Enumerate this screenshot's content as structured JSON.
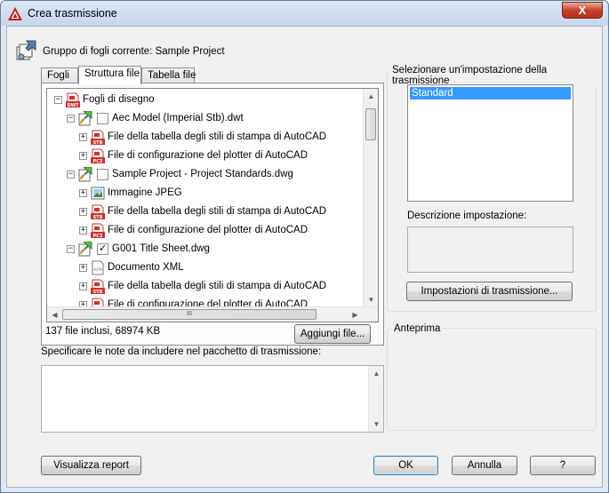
{
  "window": {
    "title": "Crea trasmissione",
    "close_label": "X"
  },
  "header": {
    "label": "Gruppo di fogli corrente: Sample Project"
  },
  "tabs": [
    {
      "label": "Fogli",
      "active": false
    },
    {
      "label": "Struttura file",
      "active": true
    },
    {
      "label": "Tabella file",
      "active": false
    }
  ],
  "tree": {
    "rows": [
      {
        "indent": 0,
        "expander": "−",
        "icon": "dwt-file-icon",
        "checkbox": null,
        "label": "Fogli di disegno"
      },
      {
        "indent": 1,
        "expander": "−",
        "icon": "drawing-icon",
        "checkbox": false,
        "label": "Aec Model (Imperial Stb).dwt"
      },
      {
        "indent": 2,
        "expander": "+",
        "icon": "stb-file-icon",
        "checkbox": null,
        "label": "File della tabella degli stili di stampa di AutoCAD"
      },
      {
        "indent": 2,
        "expander": "+",
        "icon": "pc3-file-icon",
        "checkbox": null,
        "label": "File di configurazione del plotter di AutoCAD"
      },
      {
        "indent": 1,
        "expander": "−",
        "icon": "drawing-icon",
        "checkbox": false,
        "label": "Sample Project - Project Standards.dwg"
      },
      {
        "indent": 2,
        "expander": "+",
        "icon": "jpeg-image-icon",
        "checkbox": null,
        "label": "Immagine JPEG"
      },
      {
        "indent": 2,
        "expander": "+",
        "icon": "stb-file-icon",
        "checkbox": null,
        "label": "File della tabella degli stili di stampa di AutoCAD"
      },
      {
        "indent": 2,
        "expander": "+",
        "icon": "pc3-file-icon",
        "checkbox": null,
        "label": "File di configurazione del plotter di AutoCAD"
      },
      {
        "indent": 1,
        "expander": "−",
        "icon": "drawing-icon",
        "checkbox": true,
        "label": "G001 Title Sheet.dwg"
      },
      {
        "indent": 2,
        "expander": "+",
        "icon": "xml-document-icon",
        "checkbox": null,
        "label": "Documento XML"
      },
      {
        "indent": 2,
        "expander": "+",
        "icon": "stb-file-icon",
        "checkbox": null,
        "label": "File della tabella degli stili di stampa di AutoCAD"
      },
      {
        "indent": 2,
        "expander": "+",
        "icon": "pc3-file-icon",
        "checkbox": null,
        "label": "File di configurazione del plotter di AutoCAD"
      }
    ],
    "hscroll_grip": "III"
  },
  "file_count": "137 file inclusi, 68974 KB",
  "add_file_button": "Aggiungi file...",
  "notes": {
    "label": "Specificare le note da includere nel pacchetto di trasmissione:",
    "value": ""
  },
  "setup_group": {
    "title": "Selezionare un'impostazione della trasmissione",
    "items": [
      "Standard"
    ],
    "selected": "Standard",
    "description_label": "Descrizione impostazione:",
    "description_value": "",
    "setups_button": "Impostazioni di trasmissione..."
  },
  "preview_group": {
    "title": "Anteprima"
  },
  "buttons": {
    "view_report": "Visualizza report",
    "ok": "OK",
    "cancel": "Annulla",
    "help": "?"
  },
  "colors": {
    "selection": "#3399ff",
    "close_button": "#c7432c",
    "file_icon_red": "#d0312d"
  }
}
